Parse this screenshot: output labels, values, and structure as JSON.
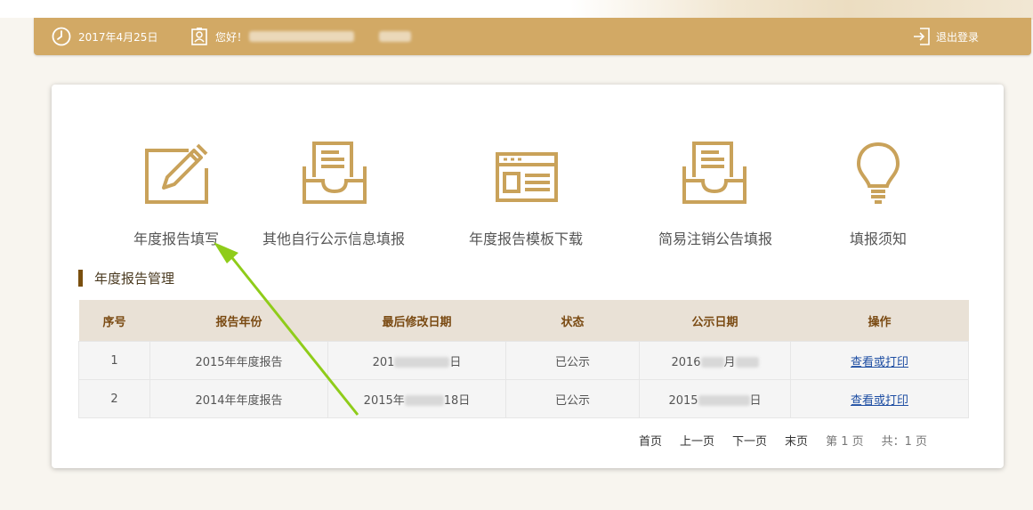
{
  "header": {
    "date": "2017年4月25日",
    "greeting": "您好！",
    "logout_label": "退出登录"
  },
  "nav": [
    {
      "label": "年度报告填写",
      "icon": "edit-pencil-icon"
    },
    {
      "label": "其他自行公示信息填报",
      "icon": "inbox-tray-icon"
    },
    {
      "label": "年度报告模板下载",
      "icon": "template-window-icon"
    },
    {
      "label": "简易注销公告填报",
      "icon": "inbox-tray-icon"
    },
    {
      "label": "填报须知",
      "icon": "lightbulb-icon"
    }
  ],
  "section_title": "年度报告管理",
  "table": {
    "headers": [
      "序号",
      "报告年份",
      "最后修改日期",
      "状态",
      "公示日期",
      "操作"
    ],
    "rows": [
      {
        "index": "1",
        "year": "2015年年度报告",
        "modified_prefix": "201",
        "modified_suffix": "日",
        "status": "已公示",
        "published_prefix": "2016",
        "published_suffix": "月",
        "action": "查看或打印"
      },
      {
        "index": "2",
        "year": "2014年年度报告",
        "modified_prefix": "2015年",
        "modified_suffix": "18日",
        "status": "已公示",
        "published_prefix": "2015",
        "published_suffix": "日",
        "action": "查看或打印"
      }
    ]
  },
  "pagination": {
    "first": "首页",
    "prev": "上一页",
    "next": "下一页",
    "last": "末页",
    "page_info": "第 1 页",
    "total_info": "共：1 页"
  },
  "colors": {
    "gold": "#d2a965",
    "icon_gold": "#c9a25a",
    "section_bar": "#7a4f0f",
    "table_header_bg": "#e9e1d6",
    "annotation_arrow": "#8fcc1a"
  }
}
